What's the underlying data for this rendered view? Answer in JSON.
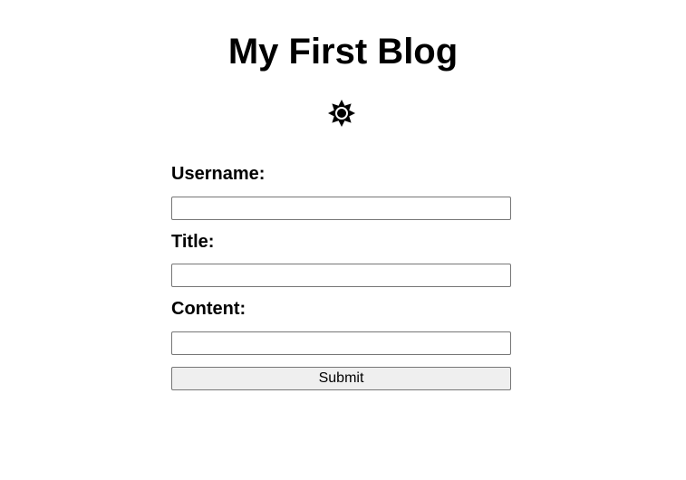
{
  "header": {
    "title": "My First Blog"
  },
  "theme_toggle": {
    "icon": "sun-icon"
  },
  "form": {
    "username_label": "Username:",
    "username_value": "",
    "title_label": "Title:",
    "title_value": "",
    "content_label": "Content:",
    "content_value": "",
    "submit_label": "Submit"
  },
  "colors": {
    "text": "#000000",
    "background": "#ffffff",
    "input_border": "#767676",
    "button_background": "#efefef"
  }
}
